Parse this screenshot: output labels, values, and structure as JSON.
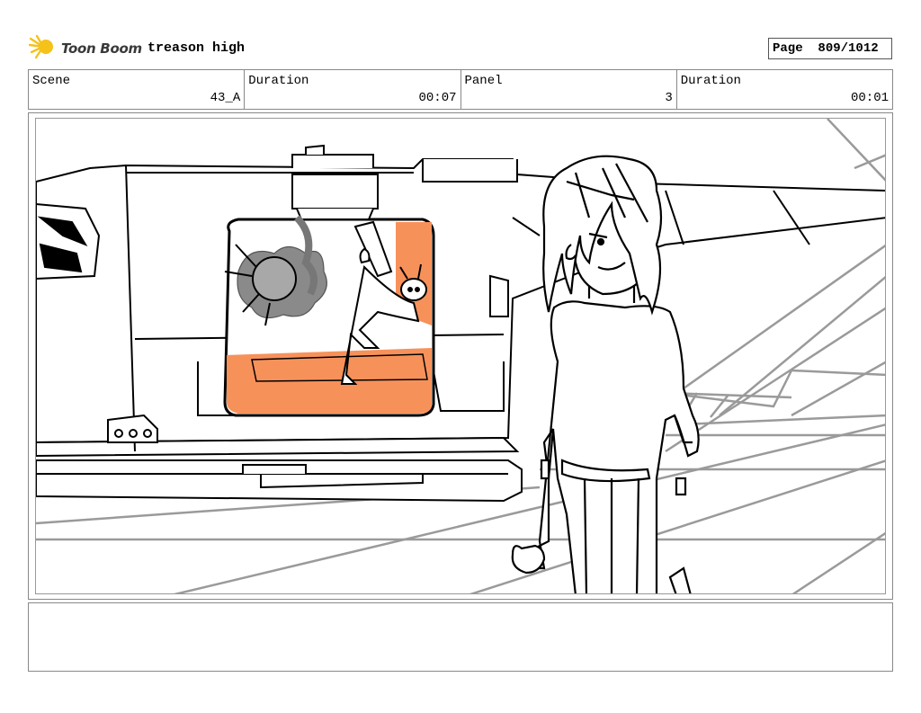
{
  "header": {
    "logo_text": "Toon Boom",
    "project_title": "treason high",
    "page_label": "Page",
    "page_number": "809/1012"
  },
  "info": {
    "scene_label": "Scene",
    "scene_value": "43_A",
    "scene_duration_label": "Duration",
    "scene_duration_value": "00:07",
    "panel_label": "Panel",
    "panel_value": "3",
    "panel_duration_label": "Duration",
    "panel_duration_value": "00:01"
  },
  "colors": {
    "accent_orange": "#f7915a",
    "logo_yellow": "#f5c21a",
    "line_gray": "#9a9a9a"
  },
  "icons": {
    "logo": "toon-boom-logo-icon"
  }
}
